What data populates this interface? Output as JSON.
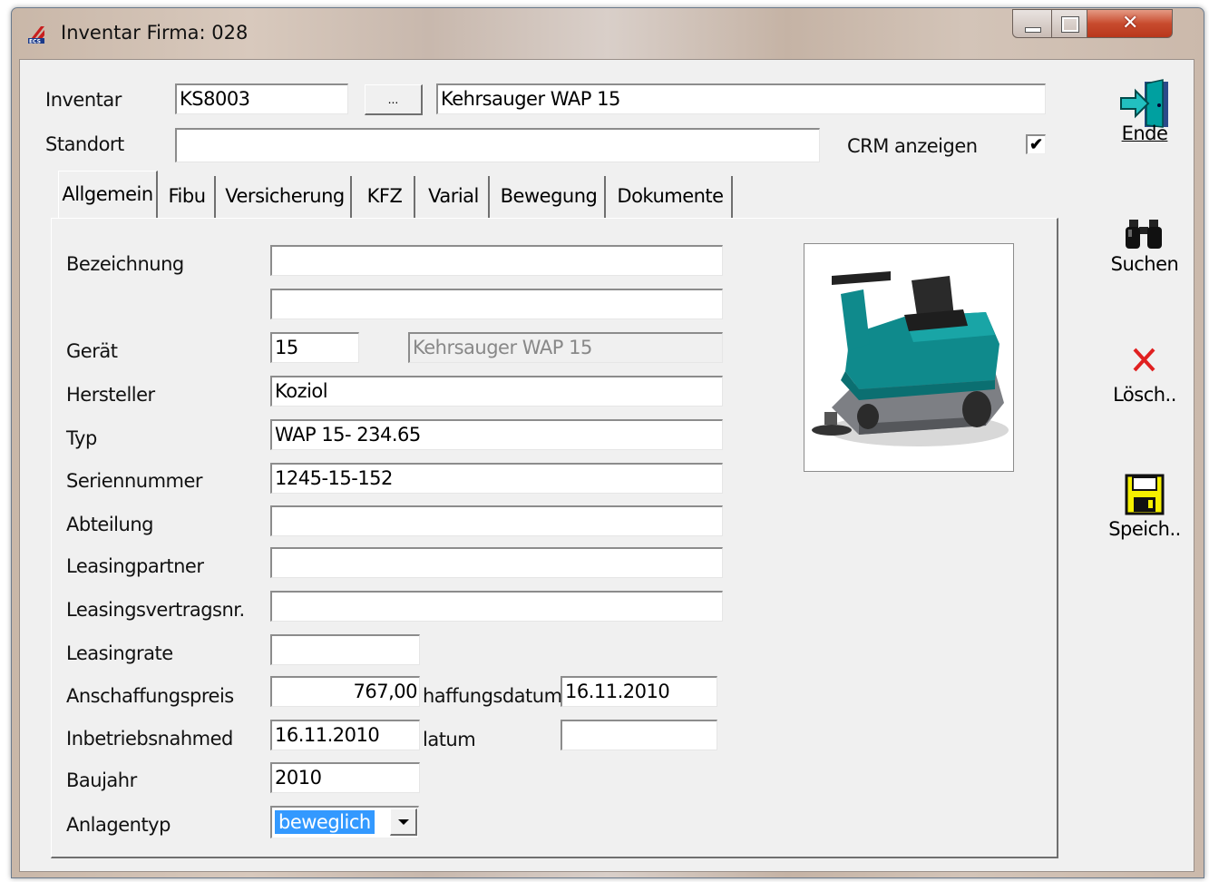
{
  "window": {
    "title": "Inventar Firma: 028",
    "app_icon": "ecs-logo-icon"
  },
  "header": {
    "inventar_label": "Inventar",
    "inventar_value": "KS8003",
    "lookup_button": "...",
    "inventar_name": "Kehrsauger WAP 15",
    "standort_label": "Standort",
    "standort_value": "",
    "crm_label": "CRM anzeigen",
    "crm_checked": true
  },
  "tabs": [
    "Allgemein",
    "Fibu",
    "Versicherung",
    "KFZ",
    "Varial",
    "Bewegung",
    "Dokumente"
  ],
  "active_tab": "Allgemein",
  "form": {
    "bezeichnung_label": "Bezeichnung",
    "bezeichnung1": "",
    "bezeichnung2": "",
    "geraet_label": "Gerät",
    "geraet_value": "15",
    "geraet_name": "Kehrsauger WAP 15",
    "hersteller_label": "Hersteller",
    "hersteller_value": "Koziol",
    "typ_label": "Typ",
    "typ_value": "WAP 15- 234.65",
    "seriennummer_label": "Seriennummer",
    "seriennummer_value": "1245-15-152",
    "abteilung_label": "Abteilung",
    "abteilung_value": "",
    "leasingpartner_label": "Leasingpartner",
    "leasingpartner_value": "",
    "leasingvertragsnr_label": "Leasingsvertragsnr.",
    "leasingvertragsnr_value": "",
    "leasingrate_label": "Leasingrate",
    "leasingrate_value": "",
    "anschaffungspreis_label": "Anschaffungspreis",
    "anschaffungspreis_value": "767,00",
    "anschaffungsdatum_label": "haffungsdatum",
    "anschaffungsdatum_value": "16.11.2010",
    "inbetriebnahme_label": "Inbetriebsnahmed",
    "inbetriebnahme_value": "16.11.2010",
    "datum_label": "latum",
    "datum_value": "",
    "baujahr_label": "Baujahr",
    "baujahr_value": "2010",
    "anlagentyp_label": "Anlagentyp",
    "anlagentyp_value": "beweglich"
  },
  "side_buttons": {
    "ende": "Ende",
    "suchen": "Suchen",
    "loeschen": "Lösch..",
    "speichern": "Speich.."
  },
  "colors": {
    "selection": "#3399ff",
    "delete_red": "#e02020",
    "save_yellow": "#f5f000",
    "exit_teal": "#00a0a0"
  }
}
